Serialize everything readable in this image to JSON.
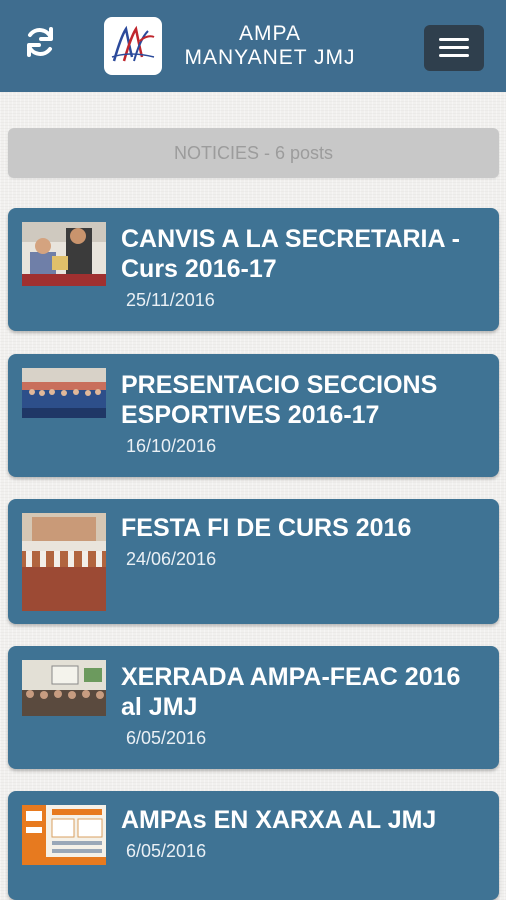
{
  "header": {
    "title_line1": "AMPA",
    "title_line2": "MANYANET JMJ",
    "refresh_icon": "refresh-icon",
    "menu_icon": "hamburger-menu-icon",
    "logo_icon": "ampa-logo"
  },
  "section": {
    "label": "NOTICIES - 6 posts"
  },
  "posts": [
    {
      "title": "CANVIS A LA SECRETARIA - Curs 2016-17",
      "date": "25/11/2016"
    },
    {
      "title": "PRESENTACIO SECCIONS ESPORTIVES 2016-17",
      "date": "16/10/2016"
    },
    {
      "title": "FESTA FI DE CURS 2016",
      "date": "24/06/2016"
    },
    {
      "title": "XERRADA AMPA-FEAC 2016 al JMJ",
      "date": "6/05/2016"
    },
    {
      "title": "AMPAs EN XARXA AL JMJ",
      "date": "6/05/2016"
    }
  ],
  "colors": {
    "header_bg": "#3f6d8f",
    "card_bg": "#3f7394",
    "menu_button_bg": "#2f3f4d",
    "section_header_bg": "#c8c8c8"
  }
}
